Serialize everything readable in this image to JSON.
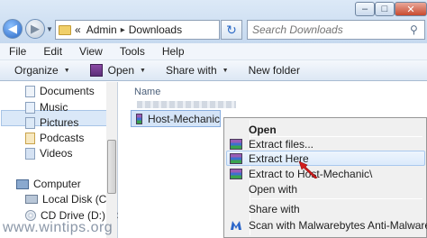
{
  "window": {
    "controls": {
      "minimize": "–",
      "maximize": "□",
      "close": "✕"
    }
  },
  "address": {
    "prefix": "«",
    "crumbs": [
      "Admin",
      "Downloads"
    ],
    "separator": "▸"
  },
  "search": {
    "placeholder": "Search Downloads"
  },
  "menu": [
    "File",
    "Edit",
    "View",
    "Tools",
    "Help"
  ],
  "toolbar": {
    "organize": "Organize",
    "open": "Open",
    "share_with": "Share with",
    "new_folder": "New folder"
  },
  "nav_tree": {
    "libraries": [
      "Documents",
      "Music",
      "Pictures",
      "Podcasts",
      "Videos"
    ],
    "computer": "Computer",
    "local_disk": "Local Disk (C:)",
    "cd_drive": "CD Drive (D:) GSP"
  },
  "content": {
    "column_name": "Name",
    "selected_file": "Host-Mechanic"
  },
  "context_menu": {
    "open": "Open",
    "extract_files": "Extract files...",
    "extract_here": "Extract Here",
    "extract_to": "Extract to Host-Mechanic\\",
    "open_with": "Open with",
    "share_with": "Share with",
    "scan": "Scan with Malwarebytes Anti-Malware"
  },
  "watermark": "www.wintips.org",
  "colors": {
    "highlight": "#dbeafb",
    "cursor_arrow": "#d41c1c"
  }
}
